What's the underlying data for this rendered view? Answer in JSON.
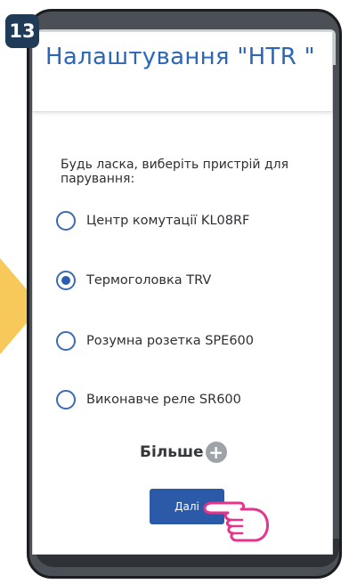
{
  "step_badge": "13",
  "header": {
    "title": "Налаштування \"HTR \""
  },
  "prompt": "Будь ласка, виберіть пристрій для парування:",
  "options": [
    {
      "label": "Центр комутації KL08RF",
      "selected": false
    },
    {
      "label": "Термоголовка TRV",
      "selected": true
    },
    {
      "label": "Розумна розетка SPE600",
      "selected": false
    },
    {
      "label": "Виконавче реле SR600",
      "selected": false
    }
  ],
  "more": {
    "label": "Більше",
    "icon": "plus-icon"
  },
  "next_button": {
    "label": "Далі"
  },
  "colors": {
    "accent": "#2c66b8",
    "button": "#2a5aa8",
    "arrow": "#f7c85a",
    "hand": "#e6348c",
    "badge": "#1f3b57"
  }
}
